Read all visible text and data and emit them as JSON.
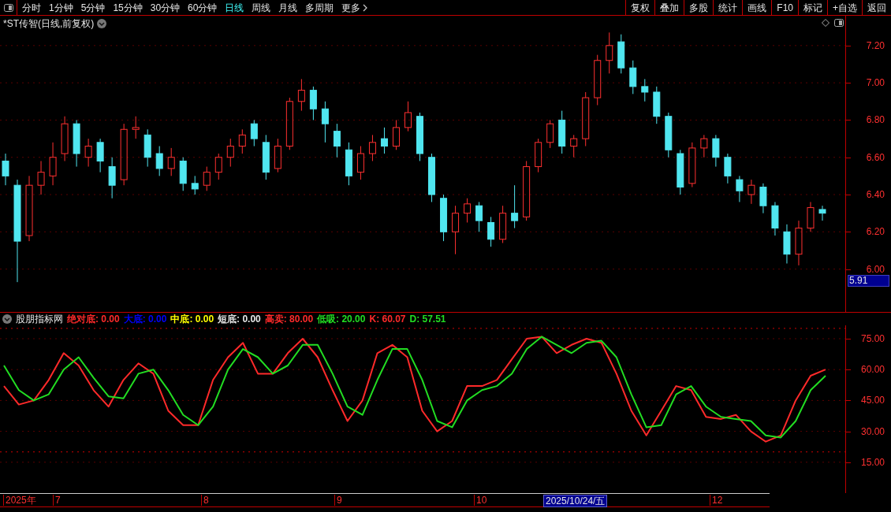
{
  "toolbar": {
    "periods": [
      {
        "label": "分时",
        "selected": false
      },
      {
        "label": "1分钟",
        "selected": false
      },
      {
        "label": "5分钟",
        "selected": false
      },
      {
        "label": "15分钟",
        "selected": false
      },
      {
        "label": "30分钟",
        "selected": false
      },
      {
        "label": "60分钟",
        "selected": false
      },
      {
        "label": "日线",
        "selected": true
      },
      {
        "label": "周线",
        "selected": false
      },
      {
        "label": "月线",
        "selected": false
      },
      {
        "label": "多周期",
        "selected": false
      }
    ],
    "more": "更多",
    "actions": [
      "复权",
      "叠加",
      "多股",
      "统计",
      "画线",
      "F10",
      "标记",
      "+自选",
      "返回"
    ]
  },
  "chart_title": "*ST传智(日线,前复权)",
  "price_chart": {
    "current_price": "5.91",
    "chart_data": {
      "type": "candlestick",
      "ylim": [
        5.77,
        7.36
      ],
      "yticks": [
        {
          "value": 7.2,
          "label": "7.20"
        },
        {
          "value": 7.0,
          "label": "7.00"
        },
        {
          "value": 6.8,
          "label": "6.80"
        },
        {
          "value": 6.6,
          "label": "6.60"
        },
        {
          "value": 6.4,
          "label": "6.40"
        },
        {
          "value": 6.2,
          "label": "6.20"
        },
        {
          "value": 6.0,
          "label": "6.00"
        }
      ],
      "grid": true,
      "ohlc": [
        [
          6.58,
          6.62,
          6.45,
          6.5
        ],
        [
          6.45,
          6.48,
          5.93,
          6.15
        ],
        [
          6.18,
          6.5,
          6.15,
          6.45
        ],
        [
          6.45,
          6.58,
          6.4,
          6.52
        ],
        [
          6.5,
          6.68,
          6.45,
          6.6
        ],
        [
          6.62,
          6.82,
          6.58,
          6.78
        ],
        [
          6.78,
          6.8,
          6.55,
          6.62
        ],
        [
          6.6,
          6.7,
          6.55,
          6.66
        ],
        [
          6.68,
          6.7,
          6.52,
          6.58
        ],
        [
          6.55,
          6.6,
          6.38,
          6.45
        ],
        [
          6.48,
          6.78,
          6.45,
          6.75
        ],
        [
          6.75,
          6.82,
          6.7,
          6.76
        ],
        [
          6.72,
          6.75,
          6.55,
          6.6
        ],
        [
          6.62,
          6.66,
          6.5,
          6.54
        ],
        [
          6.54,
          6.65,
          6.5,
          6.6
        ],
        [
          6.58,
          6.6,
          6.42,
          6.46
        ],
        [
          6.46,
          6.5,
          6.4,
          6.43
        ],
        [
          6.45,
          6.55,
          6.42,
          6.52
        ],
        [
          6.52,
          6.62,
          6.48,
          6.6
        ],
        [
          6.6,
          6.7,
          6.55,
          6.66
        ],
        [
          6.66,
          6.75,
          6.62,
          6.72
        ],
        [
          6.78,
          6.8,
          6.66,
          6.7
        ],
        [
          6.68,
          6.72,
          6.48,
          6.52
        ],
        [
          6.54,
          6.7,
          6.52,
          6.66
        ],
        [
          6.66,
          6.92,
          6.64,
          6.9
        ],
        [
          6.9,
          7.02,
          6.85,
          6.96
        ],
        [
          6.96,
          6.98,
          6.8,
          6.86
        ],
        [
          6.86,
          6.9,
          6.68,
          6.78
        ],
        [
          6.74,
          6.78,
          6.6,
          6.66
        ],
        [
          6.64,
          6.68,
          6.45,
          6.5
        ],
        [
          6.52,
          6.66,
          6.48,
          6.62
        ],
        [
          6.62,
          6.72,
          6.58,
          6.68
        ],
        [
          6.7,
          6.76,
          6.62,
          6.66
        ],
        [
          6.66,
          6.8,
          6.64,
          6.76
        ],
        [
          6.76,
          6.9,
          6.74,
          6.84
        ],
        [
          6.82,
          6.84,
          6.58,
          6.62
        ],
        [
          6.6,
          6.62,
          6.36,
          6.4
        ],
        [
          6.38,
          6.4,
          6.15,
          6.2
        ],
        [
          6.2,
          6.34,
          6.08,
          6.3
        ],
        [
          6.3,
          6.38,
          6.25,
          6.35
        ],
        [
          6.34,
          6.36,
          6.2,
          6.26
        ],
        [
          6.25,
          6.28,
          6.12,
          6.16
        ],
        [
          6.16,
          6.34,
          6.14,
          6.3
        ],
        [
          6.3,
          6.45,
          6.22,
          6.26
        ],
        [
          6.28,
          6.58,
          6.26,
          6.55
        ],
        [
          6.55,
          6.7,
          6.52,
          6.68
        ],
        [
          6.68,
          6.8,
          6.65,
          6.78
        ],
        [
          6.8,
          6.85,
          6.62,
          6.66
        ],
        [
          6.66,
          6.72,
          6.6,
          6.7
        ],
        [
          6.7,
          6.95,
          6.66,
          6.92
        ],
        [
          6.92,
          7.15,
          6.88,
          7.12
        ],
        [
          7.12,
          7.27,
          7.05,
          7.2
        ],
        [
          7.22,
          7.26,
          7.05,
          7.08
        ],
        [
          7.08,
          7.12,
          6.94,
          6.98
        ],
        [
          6.98,
          7.02,
          6.9,
          6.95
        ],
        [
          6.95,
          6.98,
          6.78,
          6.82
        ],
        [
          6.82,
          6.84,
          6.6,
          6.64
        ],
        [
          6.62,
          6.64,
          6.4,
          6.44
        ],
        [
          6.46,
          6.68,
          6.44,
          6.65
        ],
        [
          6.65,
          6.72,
          6.6,
          6.7
        ],
        [
          6.7,
          6.72,
          6.55,
          6.6
        ],
        [
          6.6,
          6.62,
          6.46,
          6.5
        ],
        [
          6.48,
          6.5,
          6.36,
          6.42
        ],
        [
          6.4,
          6.48,
          6.35,
          6.45
        ],
        [
          6.44,
          6.46,
          6.3,
          6.34
        ],
        [
          6.34,
          6.36,
          6.18,
          6.22
        ],
        [
          6.2,
          6.24,
          6.03,
          6.08
        ],
        [
          6.08,
          6.26,
          6.02,
          6.22
        ],
        [
          6.22,
          6.36,
          6.2,
          6.33
        ],
        [
          6.32,
          6.34,
          6.26,
          6.3
        ]
      ]
    }
  },
  "indicator": {
    "name": "股朋指标网",
    "legend": [
      {
        "label": "绝对底: 0.00",
        "color": "#ff2a2a"
      },
      {
        "label": "大底: 0.00",
        "color": "#0000ff"
      },
      {
        "label": "中底: 0.00",
        "color": "#ffff00"
      },
      {
        "label": "短底: 0.00",
        "color": "#e6e6e6"
      },
      {
        "label": "高卖: 80.00",
        "color": "#ff2a2a"
      },
      {
        "label": "低吸: 20.00",
        "color": "#22dd22"
      },
      {
        "label": "K: 60.07",
        "color": "#ff2a2a"
      },
      {
        "label": "D: 57.51",
        "color": "#22dd22"
      }
    ],
    "chart_data": {
      "type": "line",
      "ylim": [
        0,
        81.5
      ],
      "yticks": [
        {
          "value": 75,
          "label": "75.00"
        },
        {
          "value": 60,
          "label": "60.00"
        },
        {
          "value": 45,
          "label": "45.00"
        },
        {
          "value": 30,
          "label": "30.00"
        },
        {
          "value": 15,
          "label": "15.00"
        }
      ],
      "grid": true,
      "ref_lines": [
        {
          "axis": "y",
          "value": 80
        },
        {
          "axis": "y",
          "value": 20
        }
      ],
      "series": [
        {
          "color": "#ff2a2a",
          "values": [
            52,
            43,
            45,
            55,
            68,
            62,
            50,
            42,
            55,
            63,
            58,
            40,
            33,
            33,
            55,
            66,
            73,
            58,
            58,
            68,
            75,
            66,
            50,
            35,
            45,
            68,
            72,
            66,
            40,
            30,
            35,
            52,
            52,
            55,
            65,
            75,
            76,
            68,
            72,
            75,
            73,
            58,
            40,
            28,
            40,
            52,
            50,
            37,
            36,
            38,
            30,
            25,
            28,
            45,
            57,
            60
          ]
        },
        {
          "color": "#22dd22",
          "values": [
            62,
            50,
            45,
            48,
            60,
            66,
            56,
            47,
            46,
            58,
            60,
            50,
            38,
            33,
            42,
            60,
            70,
            66,
            58,
            62,
            72,
            72,
            58,
            42,
            38,
            55,
            70,
            70,
            55,
            35,
            32,
            45,
            50,
            52,
            58,
            70,
            76,
            72,
            68,
            73,
            74,
            66,
            48,
            32,
            33,
            48,
            52,
            42,
            37,
            36,
            35,
            28,
            27,
            35,
            50,
            57
          ]
        }
      ]
    }
  },
  "date_axis": [
    {
      "label": "2025年",
      "selected": false
    },
    {
      "label": "7",
      "selected": false
    },
    {
      "label": "8",
      "selected": false
    },
    {
      "label": "9",
      "selected": false
    },
    {
      "label": "10",
      "selected": false
    },
    {
      "label": "2025/10/24/五",
      "selected": true
    },
    {
      "label": "12",
      "selected": false
    }
  ]
}
